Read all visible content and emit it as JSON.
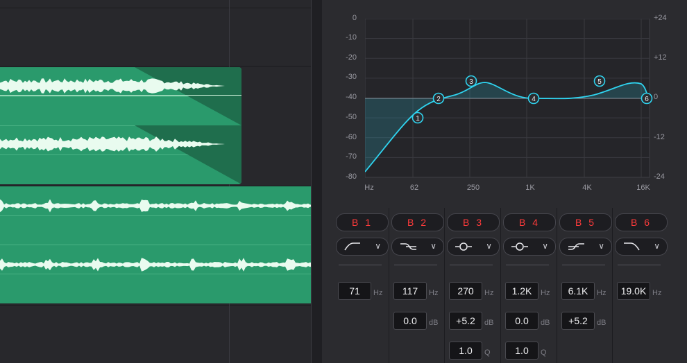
{
  "graph": {
    "y_left_labels": [
      "0",
      "-10",
      "-20",
      "-30",
      "-40",
      "-50",
      "-60",
      "-70",
      "-80"
    ],
    "y_right_labels": [
      "+24",
      "+12",
      "0",
      "-12",
      "-24"
    ],
    "x_labels": [
      "Hz",
      "62",
      "250",
      "1K",
      "4K",
      "16K"
    ],
    "nodes": [
      "1",
      "2",
      "3",
      "4",
      "5",
      "6"
    ],
    "curve_color": "#2fd4f0"
  },
  "bands": [
    {
      "label": "B 1",
      "shape": "high-pass-icon",
      "freq": "71",
      "freq_unit": "Hz"
    },
    {
      "label": "B 2",
      "shape": "low-shelf-icon",
      "freq": "117",
      "freq_unit": "Hz",
      "gain": "0.0",
      "gain_unit": "dB"
    },
    {
      "label": "B 3",
      "shape": "bell-icon",
      "freq": "270",
      "freq_unit": "Hz",
      "gain": "+5.2",
      "gain_unit": "dB",
      "q": "1.0",
      "q_unit": "Q"
    },
    {
      "label": "B 4",
      "shape": "bell-icon",
      "freq": "1.2K",
      "freq_unit": "Hz",
      "gain": "0.0",
      "gain_unit": "dB",
      "q": "1.0",
      "q_unit": "Q"
    },
    {
      "label": "B 5",
      "shape": "high-shelf-icon",
      "freq": "6.1K",
      "freq_unit": "Hz",
      "gain": "+5.2",
      "gain_unit": "dB"
    },
    {
      "label": "B 6",
      "shape": "low-pass-icon",
      "freq": "19.0K",
      "freq_unit": "Hz"
    }
  ],
  "colors": {
    "clip_green": "#2a9a6c",
    "band_label_red": "#ff3b3b",
    "eq_curve": "#2fd4f0"
  }
}
